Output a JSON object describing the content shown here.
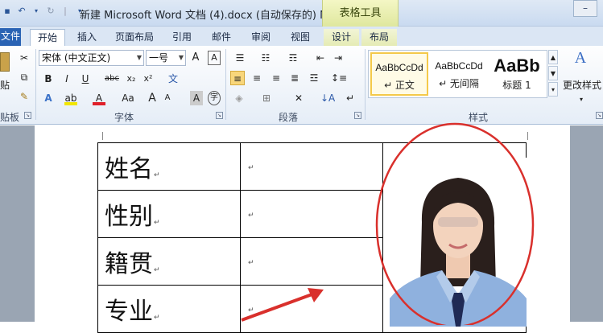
{
  "titlebar": {
    "title": "新建 Microsoft Word 文档 (4).docx (自动保存的) M",
    "context_tab": "表格工具"
  },
  "tabs": [
    "文件",
    "开始",
    "插入",
    "页面布局",
    "引用",
    "邮件",
    "审阅",
    "视图",
    "设计",
    "布局"
  ],
  "ribbon": {
    "clipboard": {
      "paste_label": "贴",
      "label": "贴板"
    },
    "font": {
      "font_name": "宋体 (中文正文)",
      "font_size": "一号",
      "label": "字体",
      "bold": "B",
      "italic": "I",
      "underline": "U",
      "strike": "abc",
      "sub": "x₂",
      "sup": "x²",
      "grow": "A",
      "shrink": "A",
      "case": "Aa"
    },
    "paragraph": {
      "label": "段落"
    },
    "styles": {
      "label": "样式",
      "items": [
        {
          "sample": "AaBbCcDd",
          "name": "↵ 正文"
        },
        {
          "sample": "AaBbCcDd",
          "name": "↵ 无间隔"
        },
        {
          "sample": "AaBb",
          "name": "标题 1"
        }
      ],
      "change_styles": "更改样式"
    }
  },
  "document": {
    "rows": [
      {
        "label": "姓名"
      },
      {
        "label": "性别"
      },
      {
        "label": "籍贯"
      },
      {
        "label": "专业"
      }
    ],
    "para_mark": "↵"
  },
  "colors": {
    "annotation": "#d9302c",
    "ribbon_accent": "#2a63b4",
    "context_tab": "#e6ec9f"
  }
}
